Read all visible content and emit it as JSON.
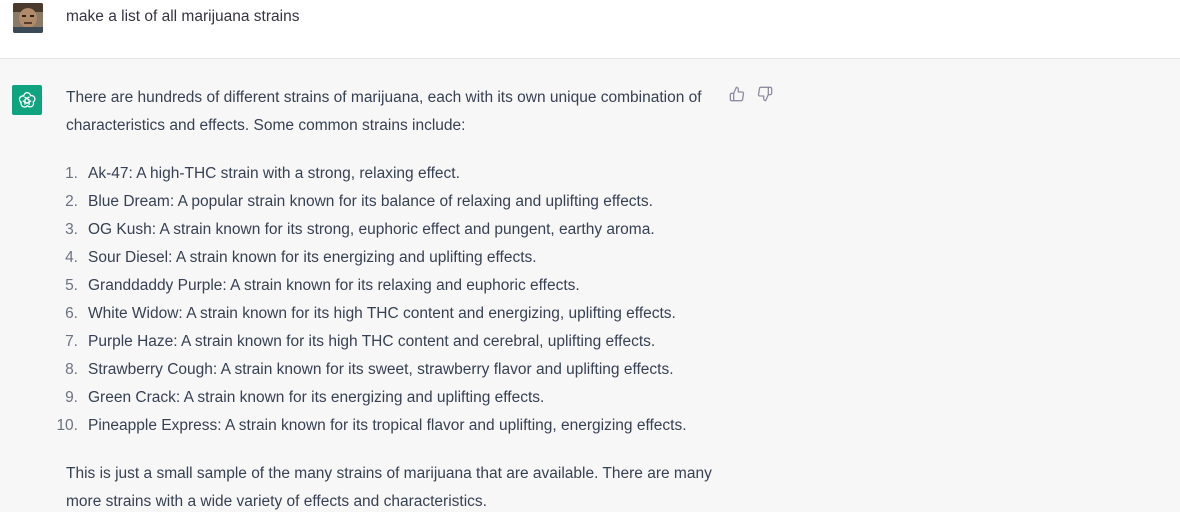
{
  "user": {
    "message": "make a list of all marijuana strains"
  },
  "assistant": {
    "intro": "There are hundreds of different strains of marijuana, each with its own unique combination of characteristics and effects. Some common strains include:",
    "items": [
      {
        "num": "1.",
        "text": "Ak-47: A high-THC strain with a strong, relaxing effect."
      },
      {
        "num": "2.",
        "text": "Blue Dream: A popular strain known for its balance of relaxing and uplifting effects."
      },
      {
        "num": "3.",
        "text": "OG Kush: A strain known for its strong, euphoric effect and pungent, earthy aroma."
      },
      {
        "num": "4.",
        "text": "Sour Diesel: A strain known for its energizing and uplifting effects."
      },
      {
        "num": "5.",
        "text": "Granddaddy Purple: A strain known for its relaxing and euphoric effects."
      },
      {
        "num": "6.",
        "text": "White Widow: A strain known for its high THC content and energizing, uplifting effects."
      },
      {
        "num": "7.",
        "text": "Purple Haze: A strain known for its high THC content and cerebral, uplifting effects."
      },
      {
        "num": "8.",
        "text": "Strawberry Cough: A strain known for its sweet, strawberry flavor and uplifting effects."
      },
      {
        "num": "9.",
        "text": "Green Crack: A strain known for its energizing and uplifting effects."
      },
      {
        "num": "10.",
        "text": "Pineapple Express: A strain known for its tropical flavor and uplifting, energizing effects."
      }
    ],
    "outro": "This is just a small sample of the many strains of marijuana that are available. There are many more strains with a wide variety of effects and characteristics."
  },
  "icons": {
    "user_avatar": "user-avatar-icon",
    "assistant_avatar": "openai-logo-icon",
    "thumbs_up": "thumbs-up-icon",
    "thumbs_down": "thumbs-down-icon"
  },
  "colors": {
    "assistant_bg": "#f7f7f8",
    "assistant_avatar_bg": "#10a37f",
    "text": "#374151"
  }
}
